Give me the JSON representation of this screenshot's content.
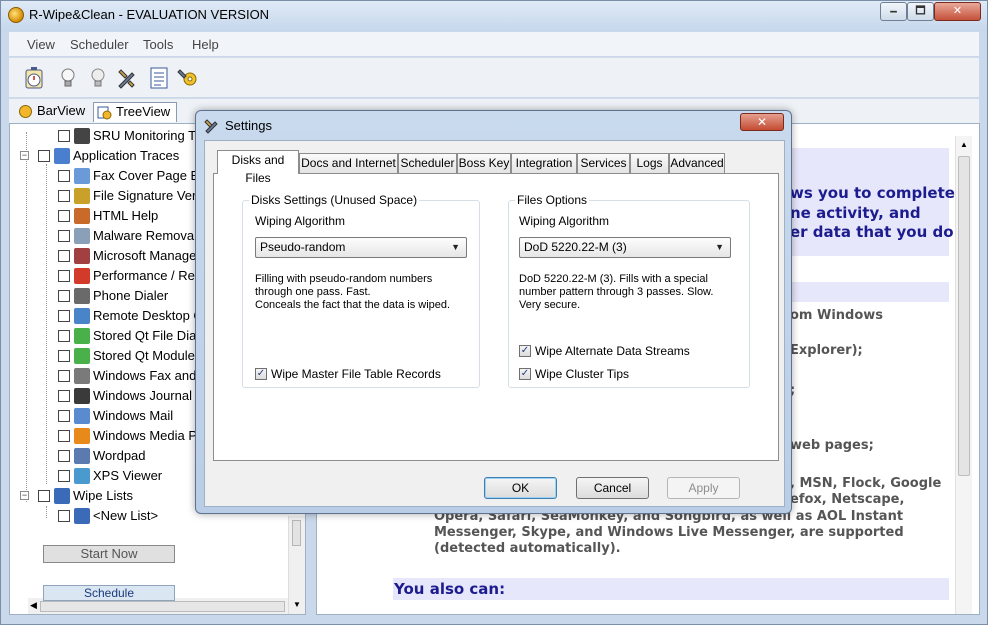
{
  "window": {
    "title": "R-Wipe&Clean - EVALUATION VERSION",
    "minimize": "🗕",
    "maximize": "🗖",
    "close": "✕"
  },
  "menu": [
    "View",
    "Scheduler",
    "Tools",
    "Help"
  ],
  "toolbar_icons": [
    "stopwatch-icon",
    "bulb-icon",
    "bulb-dim-icon",
    "wrench-icon",
    "document-list-icon",
    "gear-wrench-icon"
  ],
  "view_tabs": [
    {
      "label": "BarView",
      "icon": "barview-icon"
    },
    {
      "label": "TreeView",
      "icon": "treeview-icon"
    }
  ],
  "tree": {
    "items": [
      {
        "label": "SRU Monitoring T",
        "level": 2,
        "icon_color": "#444"
      },
      {
        "label": "Application Traces",
        "level": 1,
        "expander": "−",
        "icon_color": "#4a7fcf"
      },
      {
        "label": "Fax Cover Page Ed",
        "level": 2,
        "icon_color": "#6a9ad8"
      },
      {
        "label": "File Signature Veri",
        "level": 2,
        "icon_color": "#c8a02a"
      },
      {
        "label": "HTML Help",
        "level": 2,
        "icon_color": "#c86a2a"
      },
      {
        "label": "Malware Removal",
        "level": 2,
        "icon_color": "#8aa0b8"
      },
      {
        "label": "Microsoft Manage",
        "level": 2,
        "icon_color": "#a04040"
      },
      {
        "label": "Performance / Res",
        "level": 2,
        "icon_color": "#d23a2a"
      },
      {
        "label": "Phone Dialer",
        "level": 2,
        "icon_color": "#6a6a6a"
      },
      {
        "label": "Remote Desktop C",
        "level": 2,
        "icon_color": "#4a84c8"
      },
      {
        "label": "Stored Qt File Dia",
        "level": 2,
        "icon_color": "#4ab04a"
      },
      {
        "label": "Stored Qt Module",
        "level": 2,
        "icon_color": "#4ab04a"
      },
      {
        "label": "Windows Fax and",
        "level": 2,
        "icon_color": "#7a7a7a"
      },
      {
        "label": "Windows Journal",
        "level": 2,
        "icon_color": "#3a3a3a"
      },
      {
        "label": "Windows Mail",
        "level": 2,
        "icon_color": "#5a8ad0"
      },
      {
        "label": "Windows Media P",
        "level": 2,
        "icon_color": "#e88a1a"
      },
      {
        "label": "Wordpad",
        "level": 2,
        "icon_color": "#5a7ab0"
      },
      {
        "label": "XPS Viewer",
        "level": 2,
        "icon_color": "#4a9ad0"
      },
      {
        "label": "Wipe Lists",
        "level": 1,
        "expander": "−",
        "icon_color": "#3a6ab8"
      },
      {
        "label": "<New List>",
        "level": 2,
        "icon_color": "#3a6ab8"
      }
    ]
  },
  "buttons": {
    "start_now": "Start  Now",
    "schedule": "Schedule"
  },
  "content": {
    "line1": "ws you to completely",
    "line2": "ne activity, and",
    "line3": "er data that you do",
    "line4": "om Windows",
    "line5": "Explorer);",
    "line6": ";",
    "line7": "web pages;",
    "line8": ", MSN, Flock, Google",
    "line9": "efox, Netscape,",
    "line10": "Opera, Safari, SeaMonkey, and Songbird, as well as AOL Instant",
    "line11": "Messenger, Skype, and Windows Live Messenger, are supported",
    "line12": "(detected automatically).",
    "section2": "You also can:"
  },
  "dialog": {
    "title": "Settings",
    "close": "✕",
    "tabs": [
      "Disks and Files",
      "Docs and Internet",
      "Scheduler",
      "Boss Key",
      "Integration",
      "Services",
      "Logs",
      "Advanced"
    ],
    "disks": {
      "group_title": "Disks Settings (Unused Space)",
      "algo_label": "Wiping Algorithm",
      "algo_value": "Pseudo-random",
      "desc1": "Filling with pseudo-random numbers",
      "desc2": "through one pass. Fast.",
      "desc3": "Conceals the fact that the data is wiped.",
      "mft_label": "Wipe Master File Table Records",
      "mft_checked": true
    },
    "files": {
      "group_title": "Files Options",
      "algo_label": "Wiping Algorithm",
      "algo_value": "DoD 5220.22-M (3)",
      "desc1": "DoD 5220.22-M (3). Fills with a special",
      "desc2": "number pattern through 3 passes. Slow.",
      "desc3": "Very secure.",
      "ads_label": "Wipe Alternate Data Streams",
      "ads_checked": true,
      "tips_label": "Wipe Cluster Tips",
      "tips_checked": true
    },
    "ok": "OK",
    "cancel": "Cancel",
    "apply": "Apply",
    "check_mark": "✓",
    "dropdown_arrow": "▼"
  }
}
